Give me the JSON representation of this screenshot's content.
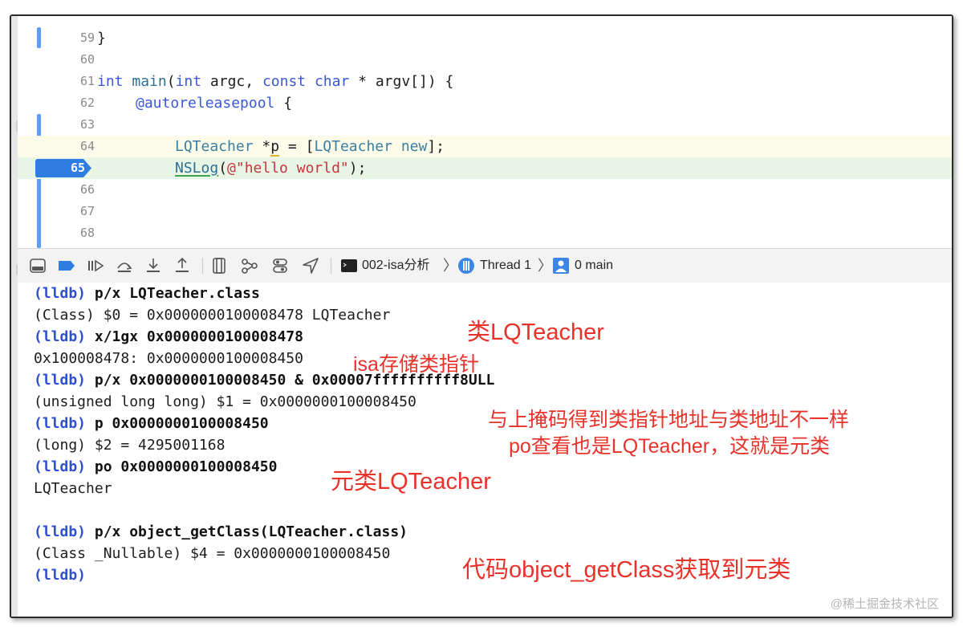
{
  "editor": {
    "lines": [
      {
        "num": "59",
        "text": "}"
      },
      {
        "num": "60",
        "text": ""
      },
      {
        "num": "61",
        "kw1": "int",
        "fn": "main",
        "p1": "(",
        "kw2": "int",
        "a1": " argc, ",
        "kw3": "const",
        "sp": " ",
        "kw4": "char",
        "a2": " * argv[]) {"
      },
      {
        "num": "62",
        "at": "@autoreleasepool",
        "rest": " {"
      },
      {
        "num": "63",
        "text": ""
      },
      {
        "num": "64",
        "cls1": "LQTeacher",
        "mid1": " *",
        "p": "p",
        "mid2": " = [",
        "cls2": "LQTeacher",
        "sp": " ",
        "cls3": "new",
        "end": "];"
      },
      {
        "num": "65",
        "fn": "NSLog",
        "open": "(",
        "str": "@\"hello world\"",
        "close": ");"
      },
      {
        "num": "66",
        "text": ""
      },
      {
        "num": "67",
        "text": ""
      },
      {
        "num": "68",
        "text": ""
      }
    ]
  },
  "toolbar": {
    "target": "002-isa分析",
    "thread": "Thread 1",
    "frame": "0 main"
  },
  "console": {
    "prompt": "(lldb)",
    "lines": [
      {
        "type": "cmd",
        "text": "p/x LQTeacher.class"
      },
      {
        "type": "out",
        "text": "(Class) $0 = 0x0000000100008478 LQTeacher"
      },
      {
        "type": "cmd",
        "text": "x/1gx 0x0000000100008478"
      },
      {
        "type": "out",
        "text": "0x100008478: 0x0000000100008450"
      },
      {
        "type": "cmd",
        "text": "p/x 0x0000000100008450 & 0x00007ffffffffff8ULL"
      },
      {
        "type": "out",
        "text": "(unsigned long long) $1 = 0x0000000100008450"
      },
      {
        "type": "cmd",
        "text": "p 0x0000000100008450"
      },
      {
        "type": "out",
        "text": "(long) $2 = 4295001168"
      },
      {
        "type": "cmd",
        "text": "po 0x0000000100008450"
      },
      {
        "type": "out",
        "text": "LQTeacher"
      },
      {
        "type": "blank",
        "text": ""
      },
      {
        "type": "cmd",
        "text": "p/x object_getClass(LQTeacher.class)"
      },
      {
        "type": "out",
        "text": "(Class _Nullable) $4 = 0x0000000100008450"
      },
      {
        "type": "cmd",
        "text": ""
      }
    ]
  },
  "annotations": {
    "a1": "类LQTeacher",
    "a2": "isa存储类指针",
    "a3": "与上掩码得到类指针地址与类地址不一样",
    "a4": "po查看也是LQTeacher，这就是元类",
    "a5": "元类LQTeacher",
    "a6": "代码object_getClass获取到元类"
  },
  "watermark": "@稀土掘金技术社区",
  "colors": {
    "prompt": "#2d4fd6",
    "annotation": "#e8322a",
    "breakpoint": "#2f7de1"
  }
}
